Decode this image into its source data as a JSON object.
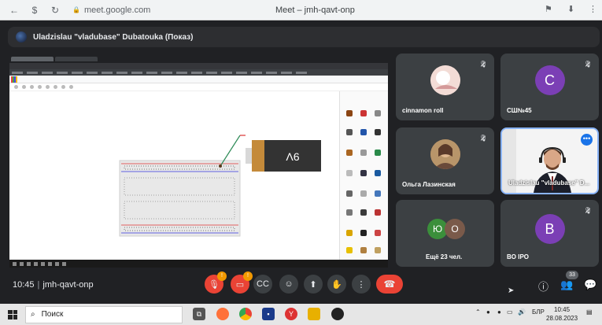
{
  "browser": {
    "url": "meet.google.com",
    "window_title": "Meet – jmh-qavt-onp",
    "nav_icons": [
      "back-arrow-icon",
      "shield-icon",
      "reload-icon"
    ],
    "right_icons": [
      "bookmark-icon",
      "download-icon",
      "menu-dots-icon"
    ]
  },
  "presenter": {
    "label": "Uladzislau \"vladubase\" Dubatouka (Показ)"
  },
  "shared_screen": {
    "battery_label": "9V",
    "colors": {
      "breadboard": "#e8e8e8",
      "battery_body": "#333333",
      "battery_cap": "#c48a3a",
      "wire": "#2e8b57"
    }
  },
  "participants": [
    {
      "name": "cinnamon roll",
      "type": "photo",
      "muted": true,
      "avatar_color": "#e8d0c8"
    },
    {
      "name": "СШ№45",
      "type": "letter",
      "letter": "C",
      "muted": true,
      "avatar_color": "#7b3fb5"
    },
    {
      "name": "Ольга Лазинская",
      "type": "photo",
      "muted": true,
      "avatar_color": "#8a6a4a"
    },
    {
      "name": "Uladzislau \"vladubase\" D...",
      "type": "video",
      "muted": false
    },
    {
      "name": "Ещё 23 чел.",
      "type": "group",
      "letters": [
        "Ю",
        "O"
      ],
      "colors": [
        "#3b8f3b",
        "#7a5a4a"
      ]
    },
    {
      "name": "BO IPO",
      "type": "letter",
      "letter": "B",
      "muted": true,
      "avatar_color": "#7b3fb5"
    }
  ],
  "controls": {
    "time": "10:45",
    "meeting_code": "jmh-qavt-onp",
    "mic_badge": "!",
    "cam_badge": "!",
    "people_count": "33"
  },
  "taskbar": {
    "search_placeholder": "Поиск",
    "language": "БЛР",
    "clock_time": "10:45",
    "clock_date": "28.08.2023"
  }
}
